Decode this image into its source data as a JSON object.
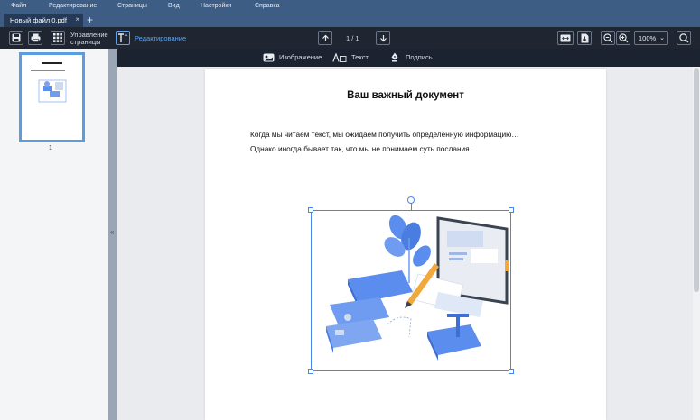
{
  "menu": {
    "items": [
      "Файл",
      "Редактирование",
      "Страницы",
      "Вид",
      "Настройки",
      "Справка"
    ]
  },
  "tabs": {
    "active": "Новый файл 0.pdf",
    "close": "×",
    "add": "+"
  },
  "toolbar": {
    "manage_pages_line1": "Управление",
    "manage_pages_line2": "страницы",
    "edit_mode": "Редактирование",
    "page_indicator": "1 / 1",
    "zoom": "100%"
  },
  "edit_toolbar": {
    "image": "Изображение",
    "text": "Текст",
    "signature": "Подпись"
  },
  "sidebar": {
    "page_number": "1",
    "collapse": "«"
  },
  "document": {
    "title": "Ваш важный документ",
    "line1": "Когда мы читаем текст, мы ожидаем получить определенную информацию…",
    "line2": "Однако иногда бывает так, что мы не понимаем суть послания."
  },
  "colors": {
    "menu_bg": "#3d5d85",
    "toolbar_bg": "#1f2631",
    "accent": "#4a86e8",
    "edit_label": "#5fa3f0"
  }
}
